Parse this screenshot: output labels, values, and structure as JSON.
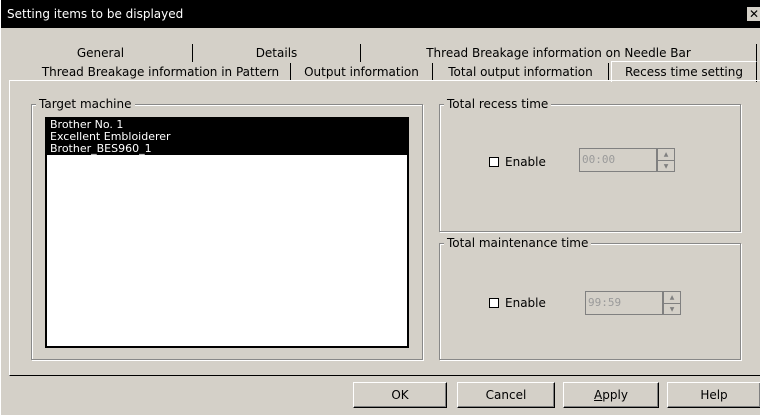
{
  "window": {
    "title": "Setting items to be displayed",
    "close_glyph": "✕"
  },
  "tabs": {
    "row_top": [
      "General",
      "Details",
      "Thread Breakage information on Needle Bar"
    ],
    "row_bottom": [
      "Thread Breakage information in Pattern",
      "Output information",
      "Total output information",
      "Recess time setting"
    ],
    "active": "Recess time setting"
  },
  "target_machine": {
    "label": "Target machine",
    "items": [
      "Brother No. 1",
      "Excellent Embloiderer",
      "Brother_BES960_1"
    ]
  },
  "total_recess_time": {
    "label": "Total recess time",
    "enable_label": "Enable",
    "enabled": false,
    "value": "00:00"
  },
  "total_maintenance_time": {
    "label": "Total maintenance time",
    "enable_label": "Enable",
    "enabled": false,
    "value": "99:59"
  },
  "buttons": {
    "ok": "OK",
    "cancel": "Cancel",
    "apply_prefix": "",
    "apply_accel": "A",
    "apply_rest": "pply",
    "help": "Help"
  }
}
